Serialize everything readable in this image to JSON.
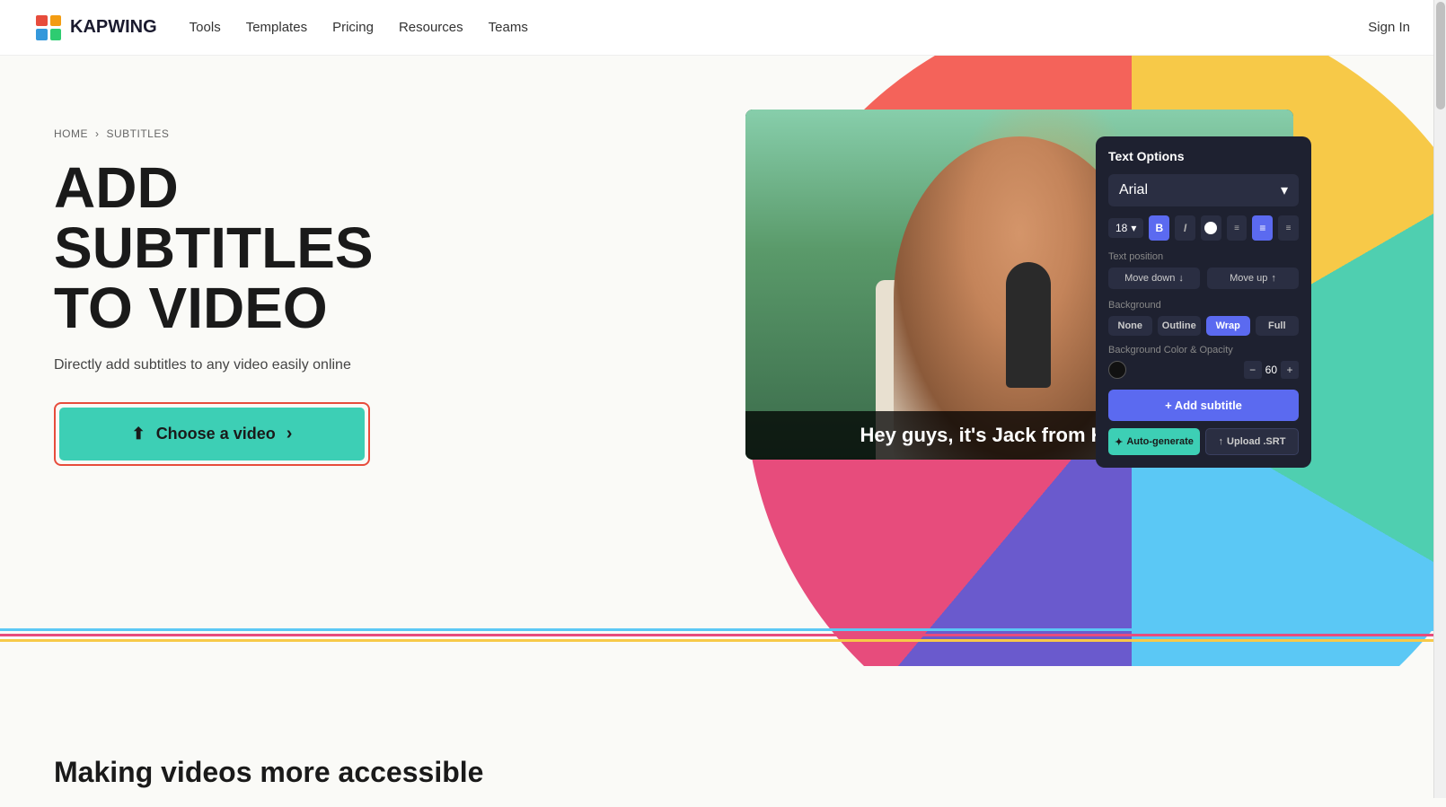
{
  "nav": {
    "logo_text": "KAPWING",
    "links": [
      {
        "label": "Tools",
        "id": "tools"
      },
      {
        "label": "Templates",
        "id": "templates"
      },
      {
        "label": "Pricing",
        "id": "pricing"
      },
      {
        "label": "Resources",
        "id": "resources"
      },
      {
        "label": "Teams",
        "id": "teams"
      }
    ],
    "sign_in": "Sign In"
  },
  "breadcrumb": {
    "home": "HOME",
    "separator": "›",
    "current": "SUBTITLES"
  },
  "hero": {
    "title_line1": "ADD SUBTITLES",
    "title_line2": "TO VIDEO",
    "subtitle": "Directly add subtitles to any video easily online",
    "cta_label": "Choose a video",
    "cta_arrow": "›"
  },
  "video": {
    "subtitle_text": "Hey guys, it's Jack from Kapwing."
  },
  "text_options_panel": {
    "title": "Text Options",
    "font_name": "Arial",
    "font_size": "18",
    "font_size_chevron": "▾",
    "chevron_down": "▾",
    "format_bold": "B",
    "format_italic": "I",
    "section_text_position": "Text position",
    "move_down": "Move down",
    "move_down_icon": "↓",
    "move_up": "Move up",
    "move_up_icon": "↑",
    "section_background": "Background",
    "bg_none": "None",
    "bg_outline": "Outline",
    "bg_wrap": "Wrap",
    "bg_full": "Full",
    "section_bg_color": "Background Color & Opacity",
    "opacity_value": "60",
    "add_subtitle_label": "+ Add subtitle",
    "auto_generate_label": "Auto-generate",
    "upload_srt_label": "Upload .SRT",
    "auto_icon": "✦",
    "upload_icon": "↑"
  },
  "bottom": {
    "heading": "Making videos more accessible"
  },
  "lines": [
    {
      "color": "#5bc8f5"
    },
    {
      "color": "#e74c7c"
    },
    {
      "color": "#f7c948"
    }
  ]
}
